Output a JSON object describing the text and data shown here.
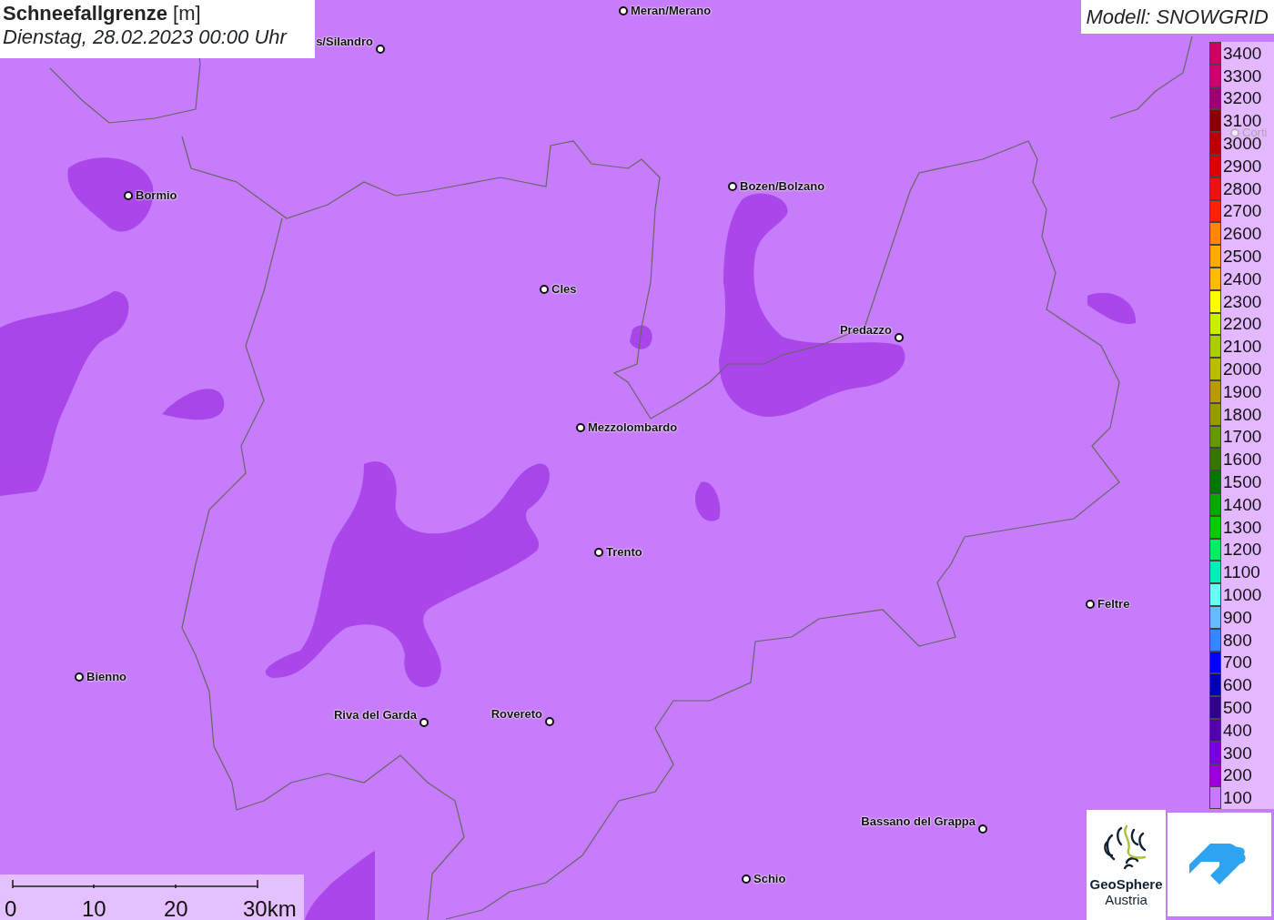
{
  "title": {
    "parameter": "Schneefallgrenze",
    "unit": "[m]",
    "datetime": "Dienstag, 28.02.2023 00:00 Uhr"
  },
  "model": "Modell: SNOWGRID",
  "cities": [
    {
      "name": "Meran/Merano",
      "faded": false
    },
    {
      "name": "s/Silandro",
      "faded": false
    },
    {
      "name": "Bormio",
      "faded": false
    },
    {
      "name": "Bozen/Bolzano",
      "faded": false
    },
    {
      "name": "Cles",
      "faded": false
    },
    {
      "name": "Predazzo",
      "faded": false
    },
    {
      "name": "Mezzolombardo",
      "faded": false
    },
    {
      "name": "Trento",
      "faded": false
    },
    {
      "name": "Feltre",
      "faded": false
    },
    {
      "name": "Bienno",
      "faded": false
    },
    {
      "name": "Riva del Garda",
      "faded": false
    },
    {
      "name": "Rovereto",
      "faded": false
    },
    {
      "name": "Bassano del Grappa",
      "faded": false
    },
    {
      "name": "Schio",
      "faded": false
    },
    {
      "name": "Corti",
      "faded": true
    }
  ],
  "legend": [
    {
      "label": "3400",
      "color": "#cc0066"
    },
    {
      "label": "3300",
      "color": "#cc0077"
    },
    {
      "label": "3200",
      "color": "#990077"
    },
    {
      "label": "3100",
      "color": "#880000"
    },
    {
      "label": "3000",
      "color": "#bb0000"
    },
    {
      "label": "2900",
      "color": "#dd0000"
    },
    {
      "label": "2800",
      "color": "#ee1111"
    },
    {
      "label": "2700",
      "color": "#ff2200"
    },
    {
      "label": "2600",
      "color": "#ff8800"
    },
    {
      "label": "2500",
      "color": "#ffaa00"
    },
    {
      "label": "2400",
      "color": "#ffbb00"
    },
    {
      "label": "2300",
      "color": "#ffff00"
    },
    {
      "label": "2200",
      "color": "#ccee00"
    },
    {
      "label": "2100",
      "color": "#aacc00"
    },
    {
      "label": "2000",
      "color": "#bbbb00"
    },
    {
      "label": "1900",
      "color": "#bb9900"
    },
    {
      "label": "1800",
      "color": "#999900"
    },
    {
      "label": "1700",
      "color": "#669900"
    },
    {
      "label": "1600",
      "color": "#337700"
    },
    {
      "label": "1500",
      "color": "#007700"
    },
    {
      "label": "1400",
      "color": "#00aa00"
    },
    {
      "label": "1300",
      "color": "#00cc00"
    },
    {
      "label": "1200",
      "color": "#00ee66"
    },
    {
      "label": "1100",
      "color": "#00eebb"
    },
    {
      "label": "1000",
      "color": "#66ffff"
    },
    {
      "label": "900",
      "color": "#66bbff"
    },
    {
      "label": "800",
      "color": "#3388ff"
    },
    {
      "label": "700",
      "color": "#0000ff"
    },
    {
      "label": "600",
      "color": "#0000bb"
    },
    {
      "label": "500",
      "color": "#330088"
    },
    {
      "label": "400",
      "color": "#5500aa"
    },
    {
      "label": "300",
      "color": "#7700dd"
    },
    {
      "label": "200",
      "color": "#9900dd"
    },
    {
      "label": "100",
      "color": "#cc77ff"
    }
  ],
  "scale": [
    "0",
    "10",
    "20",
    "30km"
  ],
  "logo": {
    "line1": "GeoSphere",
    "line2": "Austria"
  }
}
